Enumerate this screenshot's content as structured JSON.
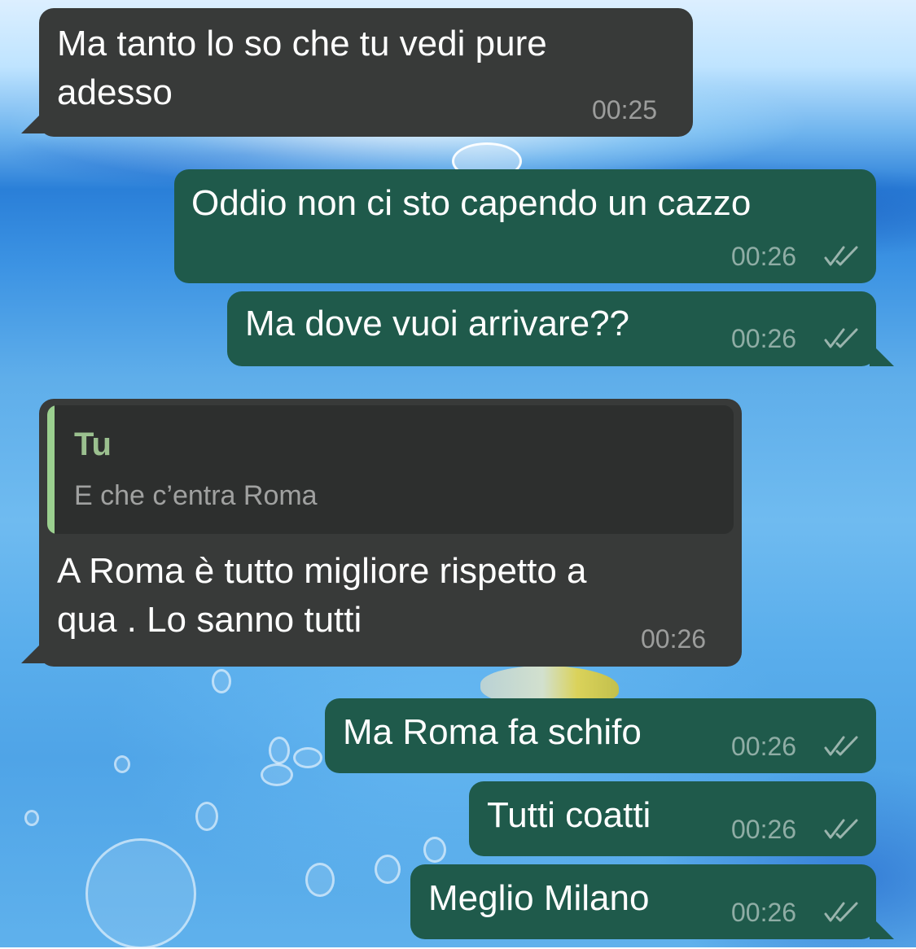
{
  "chat": {
    "messages": [
      {
        "direction": "incoming",
        "text": "Ma tanto lo so che tu vedi pure\nadesso",
        "time": "00:25"
      },
      {
        "direction": "outgoing",
        "text": "Oddio non ci sto capendo un cazzo",
        "time": "00:26",
        "status_icon": "double-check-icon"
      },
      {
        "direction": "outgoing",
        "text": "Ma dove vuoi arrivare??",
        "time": "00:26",
        "status_icon": "double-check-icon"
      },
      {
        "direction": "incoming",
        "reply_to": {
          "author": "Tu",
          "text": "E che c’entra Roma"
        },
        "text": "A Roma è tutto migliore rispetto a\nqua . Lo sanno tutti",
        "time": "00:26"
      },
      {
        "direction": "outgoing",
        "text": "Ma Roma fa schifo",
        "time": "00:26",
        "status_icon": "double-check-icon"
      },
      {
        "direction": "outgoing",
        "text": "Tutti coatti",
        "time": "00:26",
        "status_icon": "double-check-icon"
      },
      {
        "direction": "outgoing",
        "text": "Meglio Milano",
        "time": "00:26",
        "status_icon": "double-check-icon"
      }
    ]
  },
  "colors": {
    "incoming_bubble": "#383a39",
    "outgoing_bubble": "#1f5a4b",
    "reply_accent": "#9bd08f",
    "wallpaper": "#4fa4e7"
  }
}
